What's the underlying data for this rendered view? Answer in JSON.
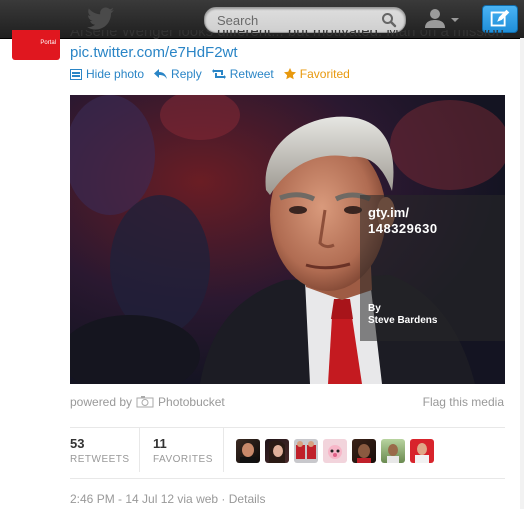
{
  "topbar": {
    "search_placeholder": "Search",
    "icons": [
      "twitter-bird-icon",
      "search-icon",
      "user-icon",
      "compose-icon"
    ]
  },
  "tweet": {
    "avatar_label": "Portal",
    "text": "Arsene Wenger looks different... but motivated. Man on a mission",
    "link": "pic.twitter.com/e7HdF2wt",
    "actions": {
      "hide_photo": "Hide photo",
      "reply": "Reply",
      "retweet": "Retweet",
      "favorited": "Favorited"
    }
  },
  "media": {
    "watermark_site": "gty.im/",
    "watermark_id": "148329630",
    "watermark_by": "By",
    "watermark_name": "Steve Bardens",
    "powered_by": "powered by",
    "provider": "Photobucket",
    "flag": "Flag this media"
  },
  "stats": {
    "retweets_count": "53",
    "retweets_label": "RETWEETS",
    "favorites_count": "11",
    "favorites_label": "FAVORITES"
  },
  "meta": {
    "timestamp": "2:46 PM - 14 Jul 12 via web",
    "separator": "·",
    "details": "Details"
  },
  "colors": {
    "link": "#2a85c6",
    "favorited": "#e8990e",
    "topbar": "#2b2b2b",
    "compose": "#2a9be6"
  }
}
